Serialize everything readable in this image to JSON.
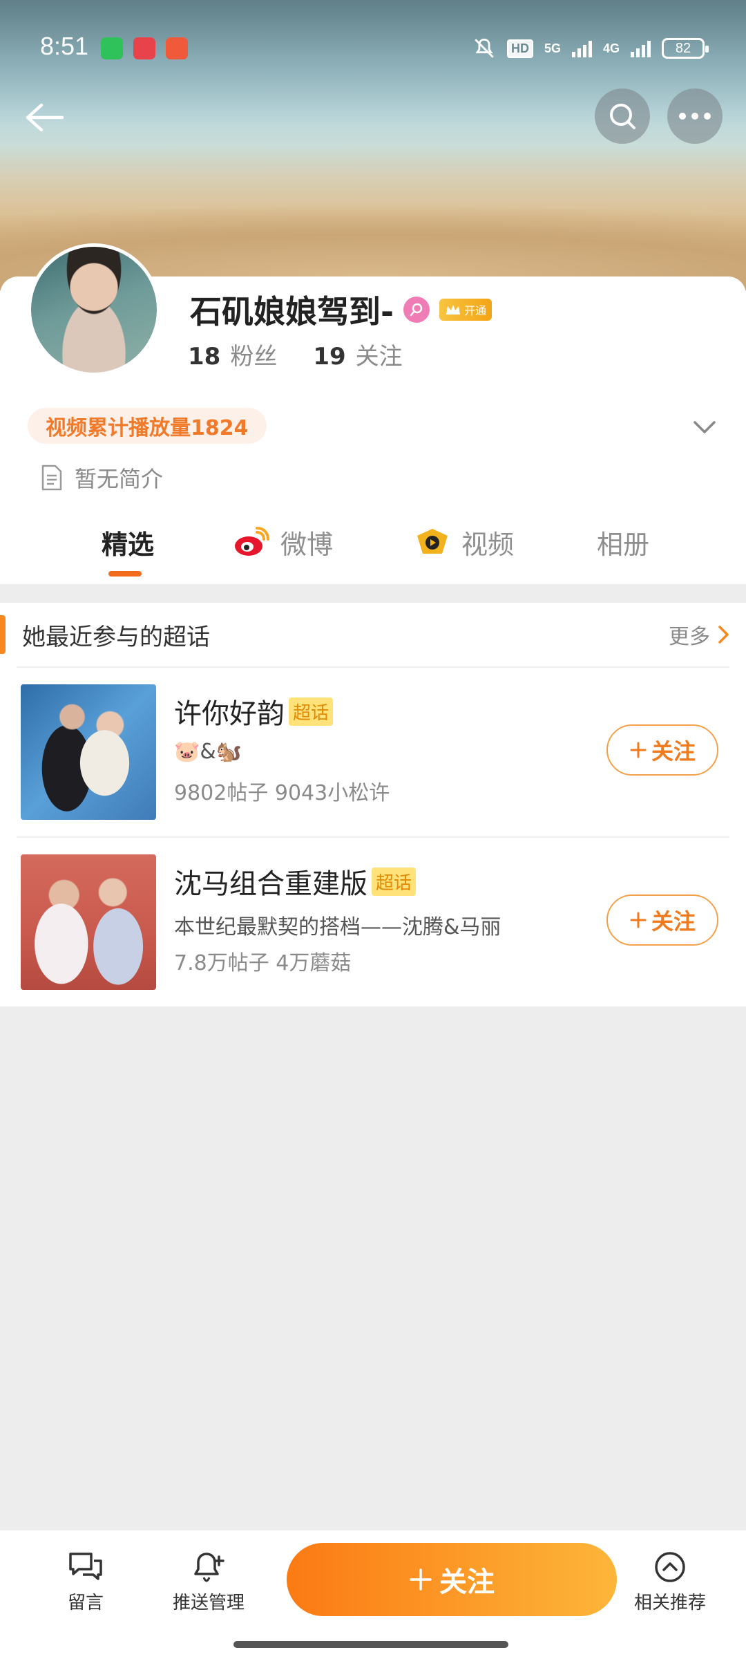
{
  "status": {
    "time": "8:51",
    "hd": "HD",
    "net1": "5G",
    "net2": "4G",
    "battery": "82"
  },
  "profile": {
    "name": "石矶娘娘驾到-",
    "vip_label": "开通",
    "fans_count": "18",
    "fans_label": "粉丝",
    "following_count": "19",
    "following_label": "关注",
    "video_plays": "视频累计播放量1824",
    "intro": "暂无简介"
  },
  "tabs": [
    {
      "label": "精选",
      "active": true
    },
    {
      "label": "微博",
      "active": false
    },
    {
      "label": "视频",
      "active": false
    },
    {
      "label": "相册",
      "active": false
    }
  ],
  "super_topics": {
    "title": "她最近参与的超话",
    "more": "更多",
    "items": [
      {
        "name": "许你好韵",
        "chip": "超话",
        "desc": "🐷&🐿️",
        "meta": "9802帖子 9043小松许",
        "follow": "关注"
      },
      {
        "name": "沈马组合重建版",
        "chip": "超话",
        "desc": "本世纪最默契的搭档——沈腾&马丽",
        "meta": "7.8万帖子 4万蘑菇",
        "follow": "关注"
      }
    ]
  },
  "bottom": {
    "comment": "留言",
    "push": "推送管理",
    "follow": "关注",
    "related": "相关推荐"
  },
  "colors": {
    "accent": "#f36c1e",
    "follow_gradient_start": "#fb7a13",
    "follow_gradient_end": "#fdb63a"
  }
}
